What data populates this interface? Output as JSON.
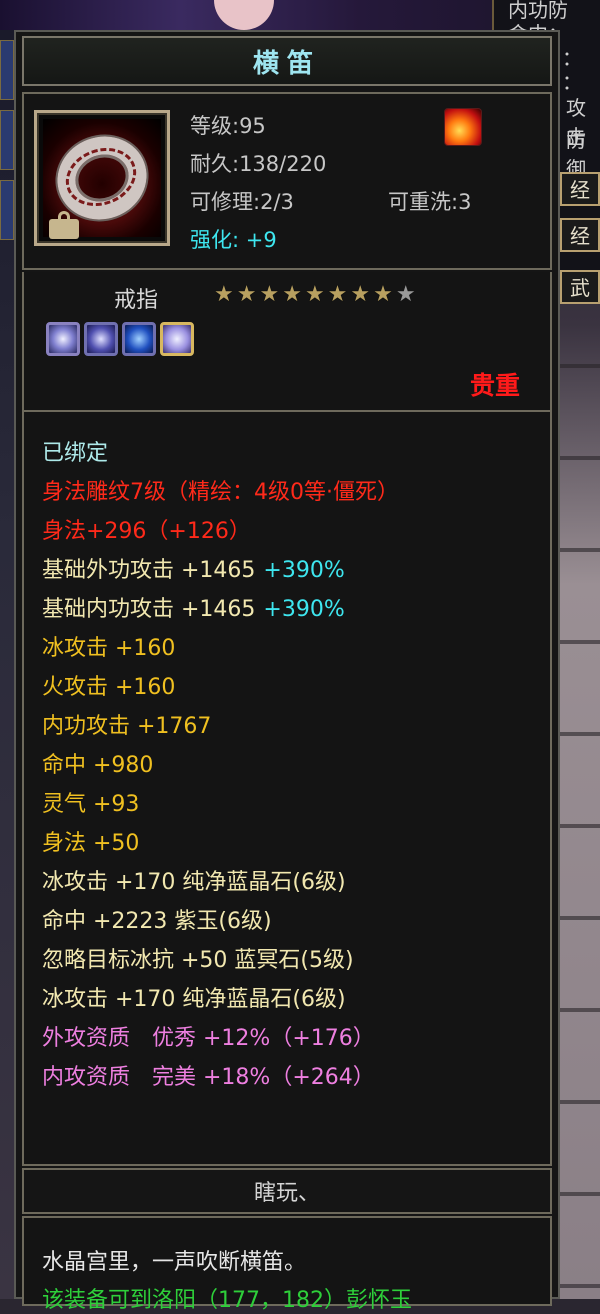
{
  "background": {
    "right_panel": {
      "lines": [
        "内功防",
        "命中：",
        "：",
        "：",
        "攻击",
        "防御"
      ],
      "buttons": [
        "经",
        "经",
        "武"
      ]
    }
  },
  "tooltip": {
    "title": "横笛",
    "header": {
      "level": "等级:95",
      "durability": "耐久:138/220",
      "repairable": "可修理:2/3",
      "rewashable": "可重洗:3",
      "enhance": "强化: +9",
      "icons": {
        "item": "ring-icon",
        "bound": "lock-icon",
        "special": "flame-icon"
      }
    },
    "type": {
      "label": "戒指",
      "stars_total": 9,
      "stars_filled": 8,
      "gems": [
        "gem-icon",
        "gem-icon",
        "gem-icon",
        "gem-icon"
      ],
      "quality": "贵重"
    },
    "attributes": [
      {
        "text": "已绑定",
        "color": "cyan"
      },
      {
        "text": "身法雕纹7级（精绘：4级0等·僵死）",
        "color": "red"
      },
      {
        "text": "身法+296（+126）",
        "color": "red"
      },
      {
        "text": "基础外功攻击 +1465",
        "extra": "+390%",
        "color": "yellow"
      },
      {
        "text": "基础内功攻击 +1465",
        "extra": "+390%",
        "color": "yellow"
      },
      {
        "text": "冰攻击 +160",
        "color": "gold"
      },
      {
        "text": "火攻击 +160",
        "color": "gold"
      },
      {
        "text": "内功攻击 +1767",
        "color": "gold"
      },
      {
        "text": "命中 +980",
        "color": "gold"
      },
      {
        "text": "灵气 +93",
        "color": "gold"
      },
      {
        "text": "身法 +50",
        "color": "gold"
      },
      {
        "text": "冰攻击 +170 纯净蓝晶石(6级)",
        "color": "yellow"
      },
      {
        "text": "命中 +2223 紫玉(6级)",
        "color": "yellow"
      },
      {
        "text": "忽略目标冰抗 +50 蓝冥石(5级)",
        "color": "yellow"
      },
      {
        "text": "冰攻击 +170 纯净蓝晶石(6级)",
        "color": "yellow"
      },
      {
        "text": "外攻资质　优秀 +12%（+176）",
        "color": "pink"
      },
      {
        "text": "内攻资质　完美 +18%（+264）",
        "color": "pink"
      }
    ],
    "flavor": {
      "title": "瞎玩、",
      "line1": "水晶宫里，一声吹断横笛。",
      "line2": "该装备可到洛阳（177，182）彭怀玉"
    }
  },
  "colors": {
    "cyan": "#aeeaea",
    "red": "#ff2a1a",
    "yellow": "#f2e8b0",
    "gold": "#f0c020",
    "pink": "#ee7fe0",
    "plus": "#3ee6ef",
    "quality": "#ff1a1a",
    "title": "#9ee5f0",
    "flavor_green": "#2ecf3a"
  }
}
